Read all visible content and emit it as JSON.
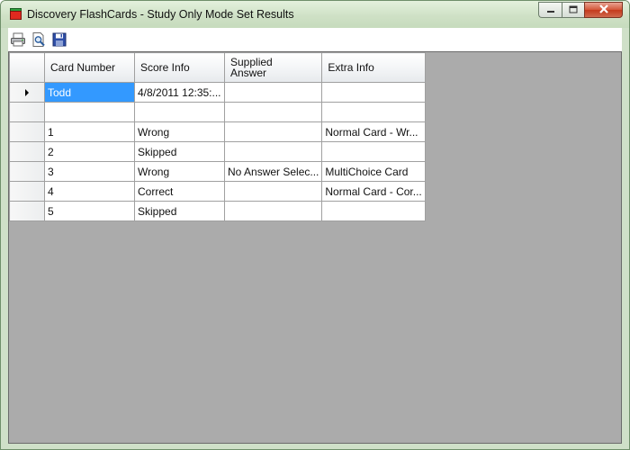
{
  "window": {
    "title": "Discovery FlashCards - Study Only Mode Set Results",
    "icon": "flashcards-app-icon",
    "accent_frame": "#cfe0c8",
    "close_color": "#c43a1c"
  },
  "toolbar": {
    "buttons": [
      {
        "icon": "print-icon"
      },
      {
        "icon": "print-preview-icon"
      },
      {
        "icon": "save-icon"
      }
    ]
  },
  "grid": {
    "columns": [
      "Card Number",
      "Score Info",
      "Supplied Answer",
      "Extra Info"
    ],
    "supplied_header_line1": "Supplied",
    "supplied_header_line2": "Answer",
    "selection_color": "#3399ff",
    "rows": [
      [
        "Todd",
        "4/8/2011 12:35:...",
        "",
        ""
      ],
      [
        "",
        "",
        "",
        ""
      ],
      [
        "1",
        "Wrong",
        "",
        "Normal Card - Wr..."
      ],
      [
        "2",
        "Skipped",
        "",
        ""
      ],
      [
        "3",
        "Wrong",
        "No Answer Selec...",
        "MultiChoice Card"
      ],
      [
        "4",
        "Correct",
        "",
        "Normal Card - Cor..."
      ],
      [
        "5",
        "Skipped",
        "",
        ""
      ]
    ],
    "current_row": 0,
    "selected_cell": [
      0,
      0
    ]
  }
}
